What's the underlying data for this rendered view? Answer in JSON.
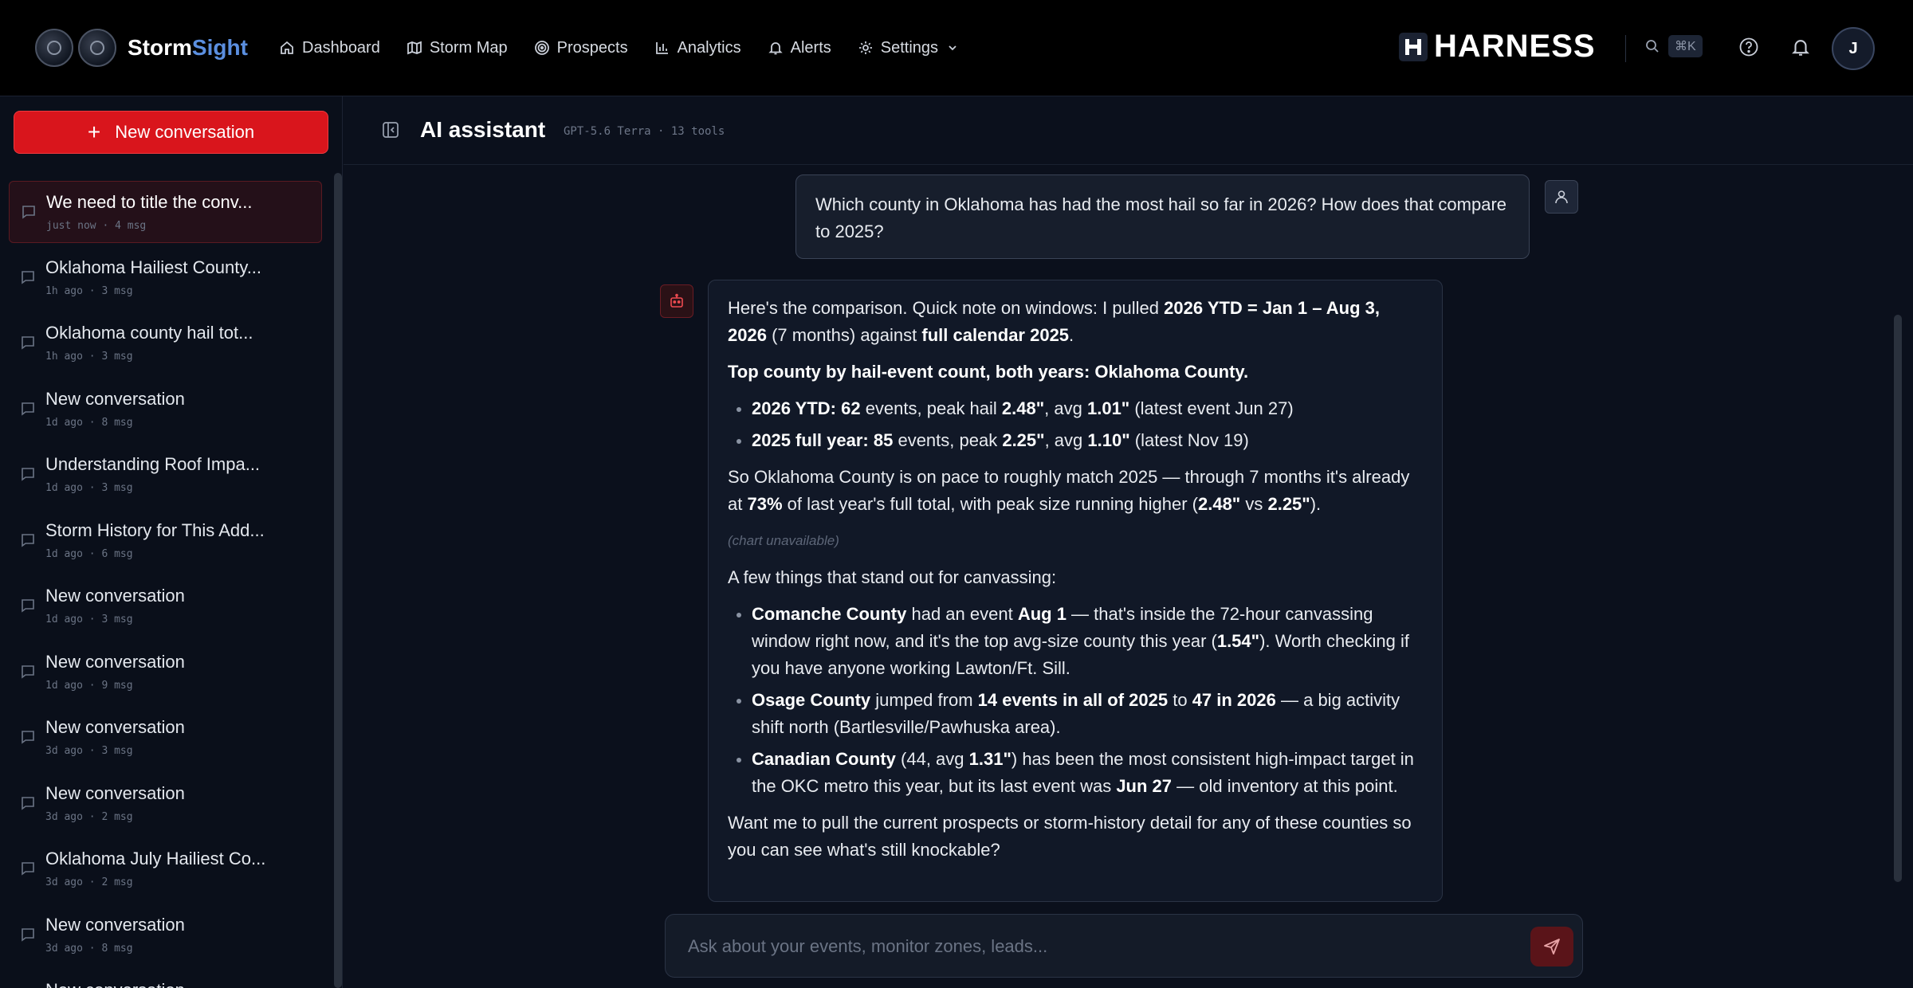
{
  "brand": {
    "name_a": "Storm",
    "name_b": "Sight",
    "accent": "#5b8fe0"
  },
  "nav": [
    {
      "label": "Dashboard",
      "icon": "home-icon"
    },
    {
      "label": "Storm Map",
      "icon": "map-icon"
    },
    {
      "label": "Prospects",
      "icon": "target-icon"
    },
    {
      "label": "Analytics",
      "icon": "bar-chart-icon"
    },
    {
      "label": "Alerts",
      "icon": "bell-icon"
    },
    {
      "label": "Settings",
      "icon": "gear-icon"
    }
  ],
  "partner": {
    "name": "HARNESS"
  },
  "search": {
    "shortcut": "⌘K"
  },
  "user": {
    "initial": "J"
  },
  "sidebar": {
    "new_button": "New conversation",
    "conversations": [
      {
        "title": "We need to title the conv...",
        "meta": "just now · 4 msg",
        "active": true
      },
      {
        "title": "Oklahoma Hailiest County...",
        "meta": "1h ago · 3 msg"
      },
      {
        "title": "Oklahoma county hail tot...",
        "meta": "1h ago · 3 msg"
      },
      {
        "title": "New conversation",
        "meta": "1d ago · 8 msg"
      },
      {
        "title": "Understanding Roof Impa...",
        "meta": "1d ago · 3 msg"
      },
      {
        "title": "Storm History for This Add...",
        "meta": "1d ago · 6 msg"
      },
      {
        "title": "New conversation",
        "meta": "1d ago · 3 msg"
      },
      {
        "title": "New conversation",
        "meta": "1d ago · 9 msg"
      },
      {
        "title": "New conversation",
        "meta": "3d ago · 3 msg"
      },
      {
        "title": "New conversation",
        "meta": "3d ago · 2 msg"
      },
      {
        "title": "Oklahoma July Hailiest Co...",
        "meta": "3d ago · 2 msg"
      },
      {
        "title": "New conversation",
        "meta": "3d ago · 8 msg"
      },
      {
        "title": "New conversation",
        "meta": ""
      }
    ]
  },
  "header": {
    "title": "AI assistant",
    "model": "GPT-5.6 Terra · 13 tools"
  },
  "chat": {
    "user_message": "Which county in Oklahoma has had the most hail so far in 2026? How does that compare to 2025?",
    "assistant": {
      "intro_a": "Here's the comparison. Quick note on windows: I pulled ",
      "intro_b": "2026 YTD = Jan 1 – Aug 3, 2026",
      "intro_c": " (7 months) against ",
      "intro_d": "full calendar 2025",
      "intro_e": ".",
      "top_county": "Top county by hail-event count, both years: Oklahoma County.",
      "b1_a": "2026 YTD: 62",
      "b1_b": " events, peak hail ",
      "b1_c": "2.48\"",
      "b1_d": ", avg ",
      "b1_e": "1.01\"",
      "b1_f": " (latest event Jun 27)",
      "b2_a": "2025 full year: 85",
      "b2_b": " events, peak ",
      "b2_c": "2.25\"",
      "b2_d": ", avg ",
      "b2_e": "1.10\"",
      "b2_f": " (latest Nov 19)",
      "pace_a": "So Oklahoma County is on pace to roughly match 2025 — through 7 months it's already at ",
      "pace_b": "73%",
      "pace_c": " of last year's full total, with peak size running higher (",
      "pace_d": "2.48\"",
      "pace_e": " vs ",
      "pace_f": "2.25\"",
      "pace_g": ").",
      "chart_note": "(chart unavailable)",
      "standout": "A few things that stand out for canvassing:",
      "c1_a": "Comanche County",
      "c1_b": " had an event ",
      "c1_c": "Aug 1",
      "c1_d": " — that's inside the 72-hour canvassing window right now, and it's the top avg-size county this year (",
      "c1_e": "1.54\"",
      "c1_f": "). Worth checking if you have anyone working Lawton/Ft. Sill.",
      "c2_a": "Osage County",
      "c2_b": " jumped from ",
      "c2_c": "14 events in all of 2025",
      "c2_d": " to ",
      "c2_e": "47 in 2026",
      "c2_f": " — a big activity shift north (Bartlesville/Pawhuska area).",
      "c3_a": "Canadian County",
      "c3_b": " (44, avg ",
      "c3_c": "1.31\"",
      "c3_d": ") has been the most consistent high-impact target in the OKC metro this year, but its last event was ",
      "c3_e": "Jun 27",
      "c3_f": " — old inventory at this point.",
      "closing": "Want me to pull the current prospects or storm-history detail for any of these counties so you can see what's still knockable?"
    },
    "composer_placeholder": "Ask about your events, monitor zones, leads..."
  },
  "colors": {
    "primary_red": "#d9151c",
    "background": "#0b101c",
    "topbar": "#000000"
  }
}
